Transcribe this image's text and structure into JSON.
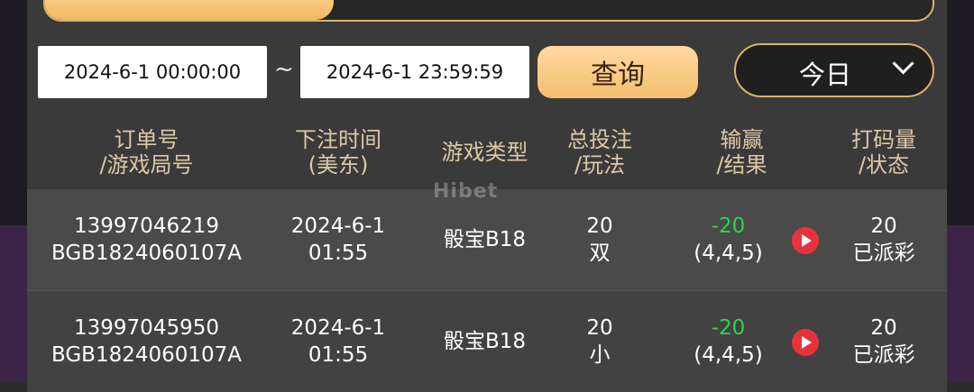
{
  "filter": {
    "start_datetime": "2024-6-1 00:00:00",
    "separator": "~",
    "end_datetime": "2024-6-1 23:59:59",
    "query_label": "查询",
    "date_range_selected": "今日"
  },
  "table": {
    "headers": [
      {
        "line1": "订单号",
        "line2": "/游戏局号"
      },
      {
        "line1": "下注时间",
        "line2": "(美东)"
      },
      {
        "line1": "游戏类型",
        "line2": ""
      },
      {
        "line1": "总投注",
        "line2": "/玩法"
      },
      {
        "line1": "输赢",
        "line2": "/结果"
      },
      {
        "line1": "打码量",
        "line2": "/状态"
      }
    ],
    "rows": [
      {
        "order_no": "13997046219",
        "round_no": "BGB1824060107A",
        "bet_date": "2024-6-1",
        "bet_time": "01:55",
        "game_type": "骰宝B18",
        "total_bet": "20",
        "play": "双",
        "win_loss": "-20",
        "result": "(4,4,5)",
        "turnover": "20",
        "status": "已派彩"
      },
      {
        "order_no": "13997045950",
        "round_no": "BGB1824060107A",
        "bet_date": "2024-6-1",
        "bet_time": "01:55",
        "game_type": "骰宝B18",
        "total_bet": "20",
        "play": "小",
        "win_loss": "-20",
        "result": "(4,4,5)",
        "turnover": "20",
        "status": "已派彩"
      }
    ]
  },
  "watermark": "Hibet",
  "colors": {
    "accent_gold": "#f3b865",
    "header_text": "#dcc8a5",
    "loss_green": "#29d64a",
    "play_red": "#e8323a"
  }
}
